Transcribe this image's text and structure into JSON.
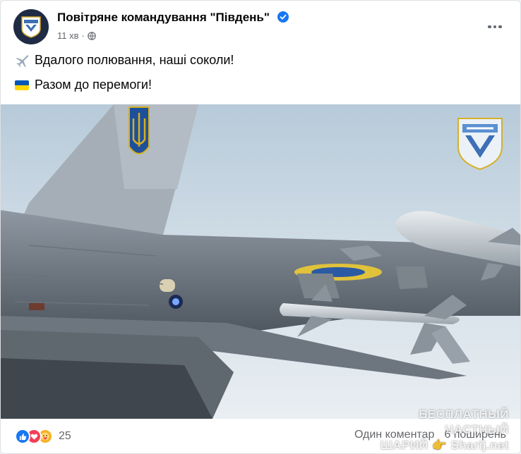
{
  "post": {
    "page_name": "Повітряне командування \"Південь\"",
    "time": "11 хв",
    "line1": "Вдалого полювання, наші соколи!",
    "line2": "Разом до перемоги!"
  },
  "icons": {
    "avatar": "air-command-south-emblem",
    "verified": "verified-badge-icon",
    "privacy": "globe-icon",
    "more": "more-options-icon",
    "line1_emoji": "airplane-emoji",
    "line2_emoji": "ukraine-flag-emoji"
  },
  "reactions": {
    "count": "25",
    "types": [
      "like",
      "love",
      "care"
    ]
  },
  "stats": {
    "comments": "Один коментар",
    "shares": "6 поширень"
  },
  "watermark": {
    "line1": "БЕСПЛАТНЫЙ ЧАСТНЫЙ",
    "line2": "ШАРИЙ 👉 Sharij.net"
  },
  "colors": {
    "accent": "#1877f2",
    "text": "#050505",
    "secondary": "#65676b",
    "sky": "#c9d8e4",
    "aircraft": "#7d8590"
  }
}
